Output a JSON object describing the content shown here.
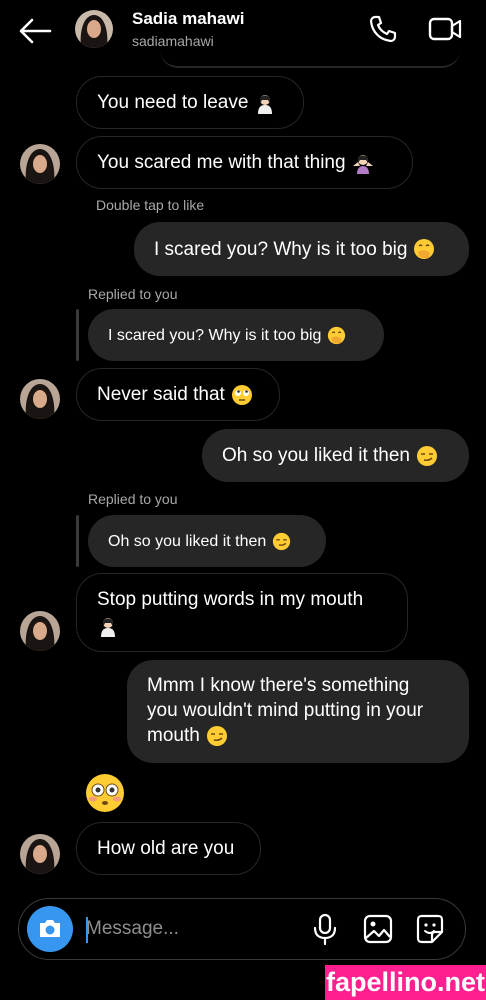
{
  "header": {
    "name": "Sadia mahawi",
    "username": "sadiamahawi"
  },
  "messages": {
    "m1": {
      "text": "You need to leave",
      "emoji": "woman-raising-hand-icon"
    },
    "m2": {
      "text": "You scared me with that thing",
      "emoji": "woman-shrugging-icon"
    },
    "m2_meta": "Double tap to like",
    "m3": {
      "text": "I scared you? Why is it too big",
      "emoji": "face-with-hand-over-mouth-icon"
    },
    "reply1_label": "Replied to you",
    "reply1_quote": "I scared you? Why is it too big",
    "m4": {
      "text": "Never said that",
      "emoji": "face-with-rolling-eyes-icon"
    },
    "m5": {
      "text": "Oh so you liked it then",
      "emoji": "smirking-face-icon"
    },
    "reply2_label": "Replied to you",
    "reply2_quote": "Oh so you liked it then",
    "m6": {
      "line1": "Stop putting words in my mouth",
      "emoji": "woman-raising-hand-icon"
    },
    "m7": {
      "line1": "Mmm I know there's something",
      "line2": "you wouldn't mind putting in your",
      "line3": "mouth",
      "emoji": "smirking-face-icon"
    },
    "m8": {
      "emoji": "flushed-face-icon"
    },
    "m9": {
      "text": "How old are you"
    }
  },
  "composer": {
    "placeholder": "Message..."
  },
  "watermark": "fapellino.net",
  "colors": {
    "background": "#000000",
    "bubble_out": "#262626",
    "bubble_in_border": "#262626",
    "accent": "#3797f0",
    "watermark": "#ff1f8e"
  }
}
